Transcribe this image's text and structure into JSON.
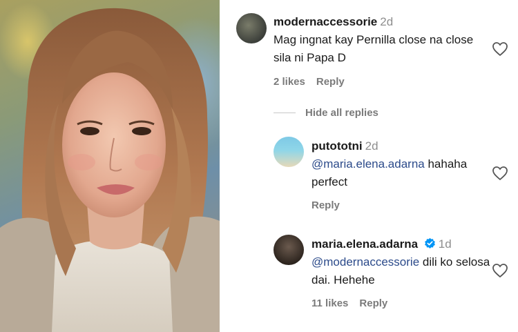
{
  "comments": [
    {
      "username": "modernaccessorie",
      "time": "2d",
      "text": "Mag ingnat kay Pernilla close na close sila ni Papa D",
      "likes": "2 likes",
      "reply": "Reply"
    }
  ],
  "hide_replies": "Hide all replies",
  "replies": [
    {
      "username": "putototni",
      "time": "2d",
      "mention": "@maria.elena.adarna",
      "text": " hahaha perfect",
      "reply": "Reply"
    },
    {
      "username": "maria.elena.adarna",
      "verified": true,
      "time": "1d",
      "mention": "@modernaccessorie",
      "text": " dili ko selosa dai. Hehehe",
      "likes": "11 likes",
      "reply": "Reply"
    }
  ],
  "colors": {
    "mention": "#2b4a8a",
    "verified": "#0095f6",
    "meta": "#7a7a7a"
  }
}
